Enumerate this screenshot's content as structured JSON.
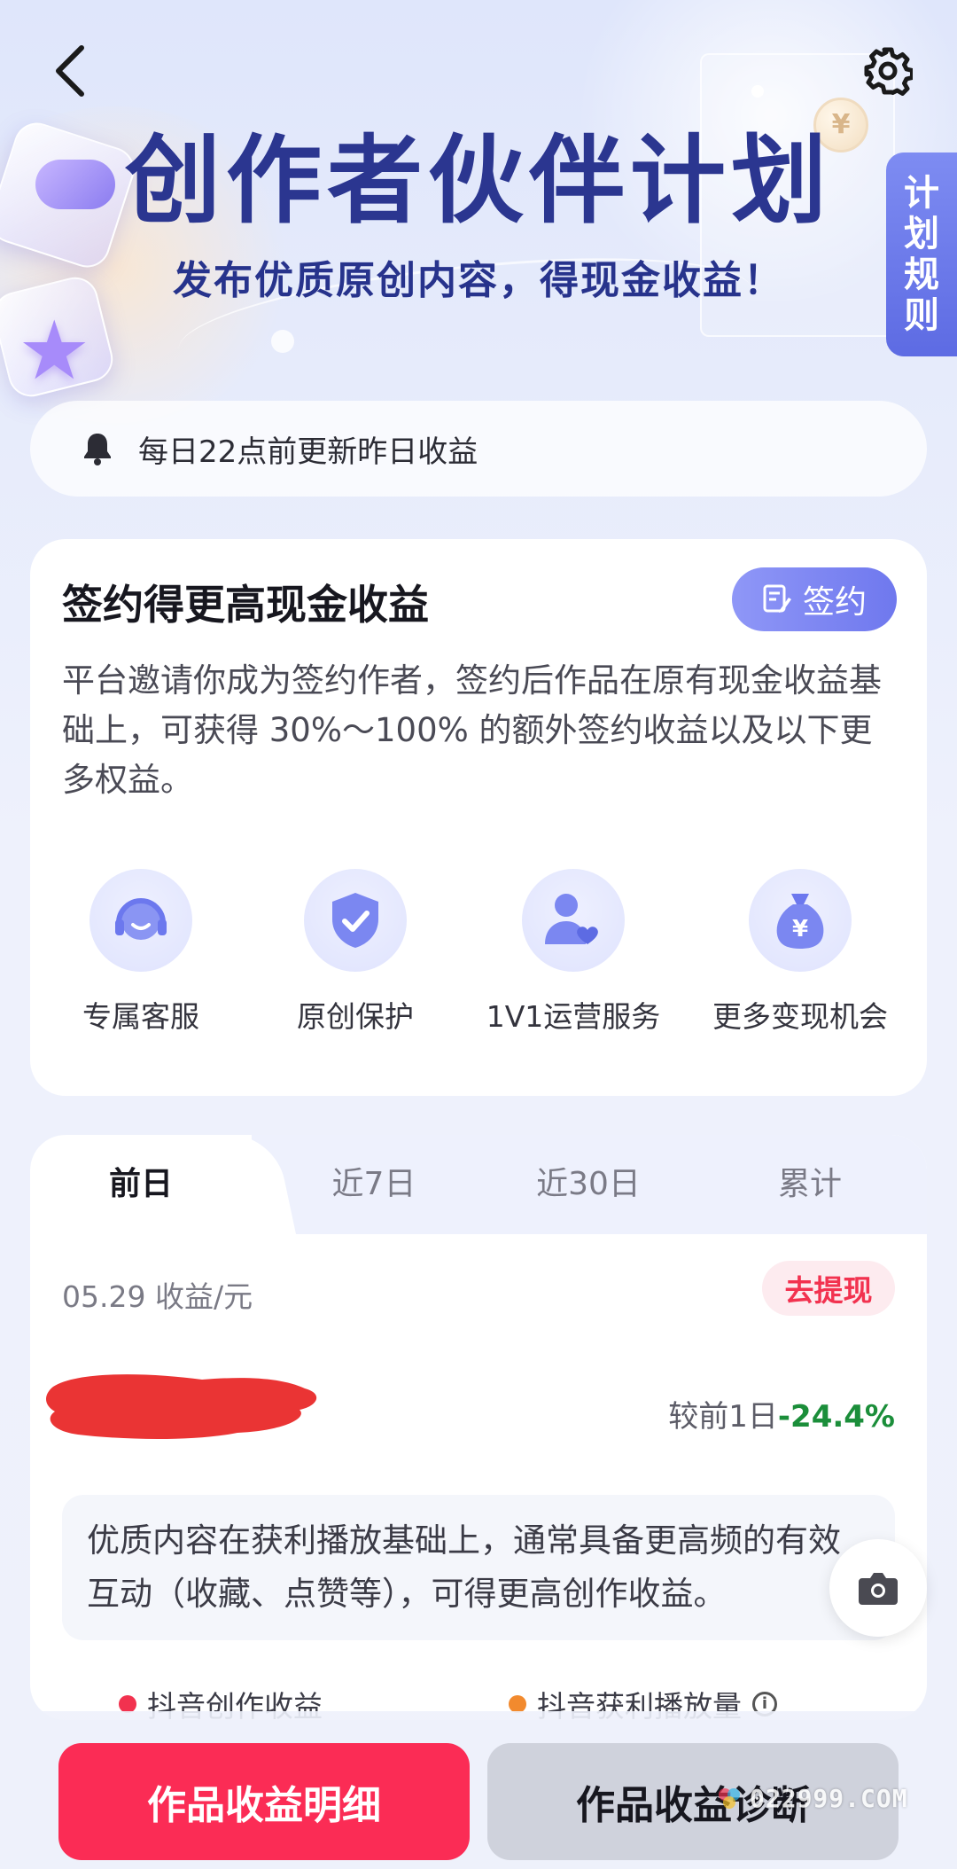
{
  "header": {
    "back_icon": "chevron-left-icon",
    "settings_icon": "gear-icon",
    "title": "创作者伙伴计划",
    "subtitle": "发布优质原创内容，得现金收益！",
    "rules_tab": "计划规则"
  },
  "notice": {
    "icon": "bell-icon",
    "text": "每日22点前更新昨日收益"
  },
  "sign_card": {
    "title": "签约得更高现金收益",
    "button_label": "签约",
    "description": "平台邀请你成为签约作者，签约后作品在原有现金收益基础上，可获得 30%～100% 的额外签约收益以及以下更多权益。",
    "benefits": [
      {
        "label": "专属客服",
        "icon": "headset-icon"
      },
      {
        "label": "原创保护",
        "icon": "shield-check-icon"
      },
      {
        "label": "1V1运营服务",
        "icon": "user-heart-icon"
      },
      {
        "label": "更多变现机会",
        "icon": "money-bag-icon"
      }
    ]
  },
  "earnings": {
    "tabs": [
      "前日",
      "近7日",
      "近30日",
      "累计"
    ],
    "active_tab": "前日",
    "date_label": "05.29 收益/元",
    "withdraw_label": "去提现",
    "compare_label": "较前1日",
    "compare_value": "-24.4%",
    "tip": "优质内容在获利播放基础上，通常具备更高频的有效互动（收藏、点赞等），可得更高创作收益。",
    "legend": [
      {
        "label": "抖音创作收益",
        "color": "#f2324f"
      },
      {
        "label": "抖音获利播放量",
        "color": "#f28a2e"
      }
    ]
  },
  "bottom": {
    "primary_button": "作品收益明细",
    "secondary_button": "作品收益诊断",
    "watermark": "022999.COM"
  },
  "colors": {
    "brand_red": "#fb2c55",
    "accent_blue": "#6f78ee",
    "title_navy": "#2b3690",
    "positive_green": "#1b8e3a"
  }
}
